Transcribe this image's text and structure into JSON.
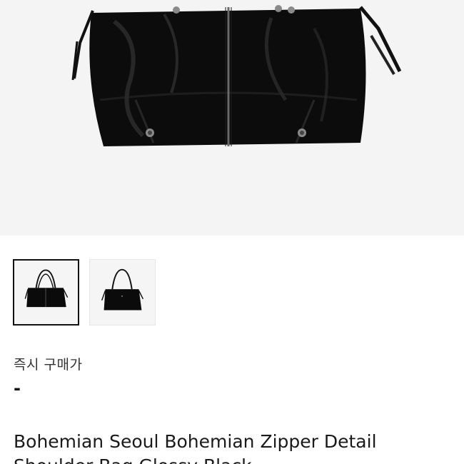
{
  "hero": {
    "image_icon": "black-tote-bag-image",
    "background_color": "#f4f4f4"
  },
  "thumbnails": [
    {
      "icon": "black-tote-bag-front-thumbnail",
      "selected": true
    },
    {
      "icon": "black-tote-bag-side-thumbnail",
      "selected": false
    }
  ],
  "price": {
    "label": "즉시 구매가",
    "value": "-"
  },
  "product": {
    "title": "Bohemian Seoul Bohemian Zipper Detail Shoulder Bag Glossy Black"
  },
  "colors": {
    "bag": "#0b0b0b",
    "text": "#1a1a1a",
    "active_border": "#111111"
  }
}
